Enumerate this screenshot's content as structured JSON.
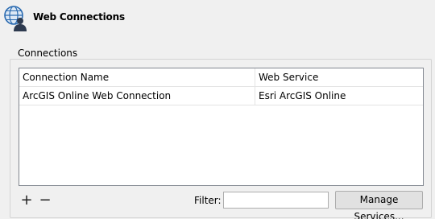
{
  "header": {
    "title": "Web Connections",
    "icon": "web-connections-icon"
  },
  "connections": {
    "group_title": "Connections",
    "columns": [
      "Connection Name",
      "Web Service"
    ],
    "rows": [
      [
        "ArcGIS Online Web Connection",
        "Esri ArcGIS Online"
      ]
    ]
  },
  "controls": {
    "add_glyph": "+",
    "remove_glyph": "−",
    "filter_label": "Filter:",
    "filter_value": "",
    "manage_button": "Manage Services..."
  }
}
